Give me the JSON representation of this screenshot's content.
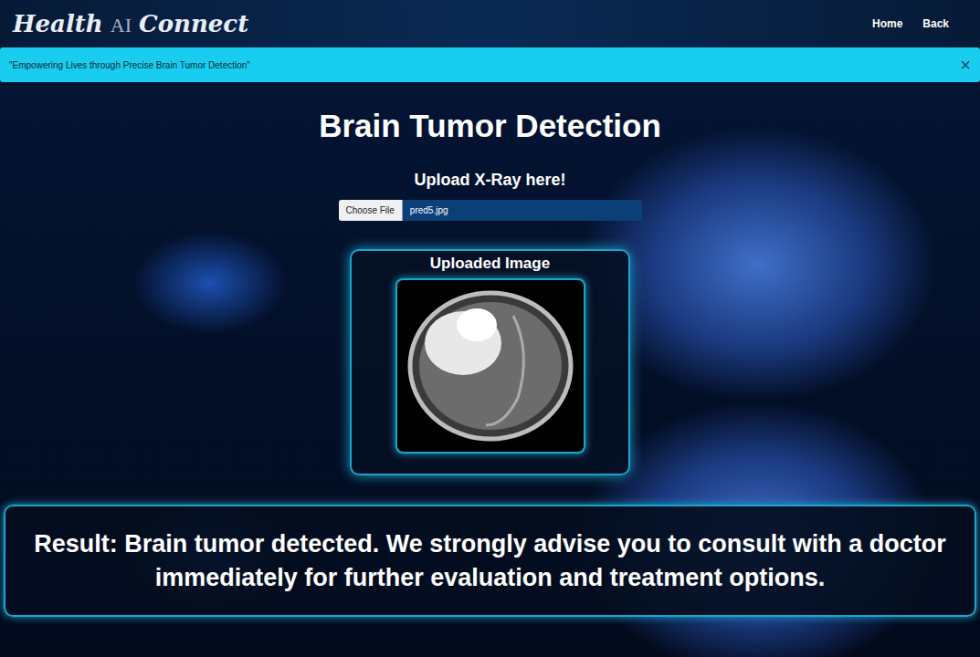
{
  "header": {
    "logo": {
      "first": "Health",
      "middle": "AI",
      "last": "Connect"
    },
    "nav": [
      {
        "label": "Home"
      },
      {
        "label": "Back"
      }
    ]
  },
  "alert": {
    "text": "\"Empowering Lives through Precise Brain Tumor Detection\"",
    "close": "×"
  },
  "main": {
    "title": "Brain Tumor Detection",
    "upload_label": "Upload X-Ray here!",
    "file_button": "Choose File",
    "file_name": "pred5.jpg",
    "preview_title": "Uploaded Image"
  },
  "result": {
    "text": "Result: Brain tumor detected. We strongly advise you to consult with a doctor immediately for further evaluation and treatment options."
  }
}
